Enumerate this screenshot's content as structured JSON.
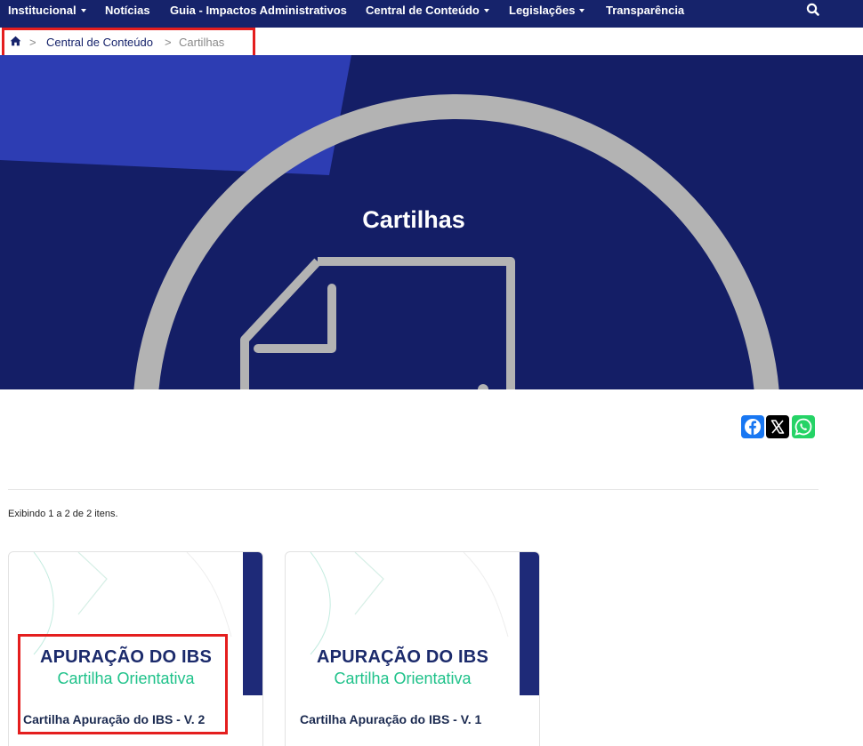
{
  "nav": {
    "items": [
      {
        "label": "Institucional",
        "dropdown": true
      },
      {
        "label": "Notícias",
        "dropdown": false
      },
      {
        "label": "Guia - Impactos Administrativos",
        "dropdown": false
      },
      {
        "label": "Central de Conteúdo",
        "dropdown": true
      },
      {
        "label": "Legislações",
        "dropdown": true
      },
      {
        "label": "Transparência",
        "dropdown": false
      }
    ],
    "search_icon": "search-icon"
  },
  "breadcrumb": {
    "home_icon": "home-icon",
    "separator": ">",
    "items": [
      "Central de Conteúdo",
      "Cartilhas"
    ]
  },
  "hero": {
    "title": "Cartilhas"
  },
  "share": {
    "icons": [
      "facebook-icon",
      "x-icon",
      "whatsapp-icon"
    ]
  },
  "listing": {
    "summary": "Exibindo 1 a 2 de 2 itens."
  },
  "cards": [
    {
      "heading": "APURAÇÃO DO IBS",
      "subheading": "Cartilha Orientativa",
      "title": "Cartilha Apuração do IBS - V. 2"
    },
    {
      "heading": "APURAÇÃO DO IBS",
      "subheading": "Cartilha Orientativa",
      "title": "Cartilha Apuração do IBS - V. 1"
    }
  ],
  "colors": {
    "nav_bg": "#16236b",
    "hero_bg": "#141e66",
    "accent_green": "#1fc28a",
    "highlight": "#e41e1e",
    "facebook": "#1877f2",
    "x": "#000000",
    "whatsapp": "#25d366"
  }
}
